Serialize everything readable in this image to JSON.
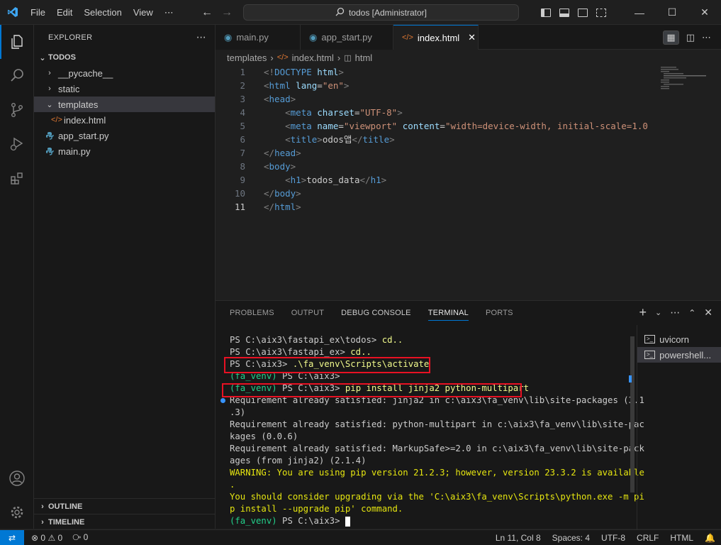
{
  "titlebar": {
    "menu": [
      "File",
      "Edit",
      "Selection",
      "View",
      "⋯"
    ],
    "search": "todos [Administrator]"
  },
  "sidebar": {
    "header": "EXPLORER",
    "root": "TODOS",
    "items": [
      {
        "label": "__pycache__",
        "kind": "folder-collapsed"
      },
      {
        "label": "static",
        "kind": "folder-collapsed"
      },
      {
        "label": "templates",
        "kind": "folder-expanded"
      },
      {
        "label": "index.html",
        "kind": "html-file"
      },
      {
        "label": "app_start.py",
        "kind": "py-file"
      },
      {
        "label": "main.py",
        "kind": "py-file"
      }
    ],
    "outline": "OUTLINE",
    "timeline": "TIMELINE"
  },
  "editor": {
    "tabs": [
      {
        "label": "main.py",
        "icon": "python-icon"
      },
      {
        "label": "app_start.py",
        "icon": "python-icon"
      },
      {
        "label": "index.html",
        "icon": "html-icon",
        "active": true
      }
    ],
    "breadcrumb": [
      "templates",
      "index.html",
      "html"
    ],
    "lines": [
      {
        "n": "1",
        "tokens": [
          [
            "tg",
            "<!"
          ],
          [
            "tn",
            "DOCTYPE"
          ],
          [
            "tx",
            " "
          ],
          [
            "at",
            "html"
          ],
          [
            "tg",
            ">"
          ]
        ]
      },
      {
        "n": "2",
        "tokens": [
          [
            "tg",
            "<"
          ],
          [
            "tn",
            "html"
          ],
          [
            "tx",
            " "
          ],
          [
            "at",
            "lang"
          ],
          [
            "tx",
            "="
          ],
          [
            "av",
            "\"en\""
          ],
          [
            "tg",
            ">"
          ]
        ]
      },
      {
        "n": "3",
        "tokens": [
          [
            "tg",
            "<"
          ],
          [
            "tn",
            "head"
          ],
          [
            "tg",
            ">"
          ]
        ]
      },
      {
        "n": "4",
        "tokens": [
          [
            "tx",
            "    "
          ],
          [
            "tg",
            "<"
          ],
          [
            "tn",
            "meta"
          ],
          [
            "tx",
            " "
          ],
          [
            "at",
            "charset"
          ],
          [
            "tx",
            "="
          ],
          [
            "av",
            "\"UTF-8\""
          ],
          [
            "tg",
            ">"
          ]
        ]
      },
      {
        "n": "5",
        "tokens": [
          [
            "tx",
            "    "
          ],
          [
            "tg",
            "<"
          ],
          [
            "tn",
            "meta"
          ],
          [
            "tx",
            " "
          ],
          [
            "at",
            "name"
          ],
          [
            "tx",
            "="
          ],
          [
            "av",
            "\"viewport\""
          ],
          [
            "tx",
            " "
          ],
          [
            "at",
            "content"
          ],
          [
            "tx",
            "="
          ],
          [
            "av",
            "\"width=device-width, initial-scale=1.0"
          ]
        ]
      },
      {
        "n": "6",
        "tokens": [
          [
            "tx",
            "    "
          ],
          [
            "tg",
            "<"
          ],
          [
            "tn",
            "title"
          ],
          [
            "tg",
            ">"
          ],
          [
            "tx",
            "odos앱"
          ],
          [
            "tg",
            "</"
          ],
          [
            "tn",
            "title"
          ],
          [
            "tg",
            ">"
          ]
        ]
      },
      {
        "n": "7",
        "tokens": [
          [
            "tg",
            "</"
          ],
          [
            "tn",
            "head"
          ],
          [
            "tg",
            ">"
          ]
        ]
      },
      {
        "n": "8",
        "tokens": [
          [
            "tg",
            "<"
          ],
          [
            "tn",
            "body"
          ],
          [
            "tg",
            ">"
          ]
        ]
      },
      {
        "n": "9",
        "tokens": [
          [
            "tx",
            "    "
          ],
          [
            "tg",
            "<"
          ],
          [
            "tn",
            "h1"
          ],
          [
            "tg",
            ">"
          ],
          [
            "tx",
            "todos_data"
          ],
          [
            "tg",
            "</"
          ],
          [
            "tn",
            "h1"
          ],
          [
            "tg",
            ">"
          ]
        ]
      },
      {
        "n": "10",
        "tokens": [
          [
            "tg",
            "</"
          ],
          [
            "tn",
            "body"
          ],
          [
            "tg",
            ">"
          ]
        ]
      },
      {
        "n": "11",
        "tokens": [
          [
            "tg",
            "</"
          ],
          [
            "tn",
            "html"
          ],
          [
            "tg",
            ">"
          ]
        ],
        "current": true
      }
    ]
  },
  "panel": {
    "tabs": [
      "PROBLEMS",
      "OUTPUT",
      "DEBUG CONSOLE",
      "TERMINAL",
      "PORTS"
    ],
    "active_tab": "TERMINAL",
    "terminal_lines": [
      [
        [
          "p",
          "PS C:\\aix3\\fastapi_ex\\todos> "
        ],
        [
          "cmd",
          "cd.."
        ]
      ],
      [
        [
          "p",
          "PS C:\\aix3\\fastapi_ex> "
        ],
        [
          "cmd",
          "cd.."
        ]
      ],
      [
        [
          "p",
          "PS C:\\aix3> "
        ],
        [
          "cmd",
          ".\\fa_venv\\Scripts\\activate"
        ]
      ],
      [
        [
          "venv",
          "(fa_venv) "
        ],
        [
          "p",
          "PS C:\\aix3>"
        ]
      ],
      [
        [
          "venv",
          "(fa_venv) "
        ],
        [
          "p",
          "PS C:\\aix3> "
        ],
        [
          "cmd",
          "pip install jinja2 python-multipart"
        ]
      ],
      [
        [
          "p",
          "Requirement already satisfied: jinja2 in c:\\aix3\\fa_venv\\lib\\site-packages (3.1"
        ]
      ],
      [
        [
          "p",
          ".3)"
        ]
      ],
      [
        [
          "p",
          "Requirement already satisfied: python-multipart in c:\\aix3\\fa_venv\\lib\\site-pac"
        ]
      ],
      [
        [
          "p",
          "kages (0.0.6)"
        ]
      ],
      [
        [
          "p",
          "Requirement already satisfied: MarkupSafe>=2.0 in c:\\aix3\\fa_venv\\lib\\site-pack"
        ]
      ],
      [
        [
          "p",
          "ages (from jinja2) (2.1.4)"
        ]
      ],
      [
        [
          "warn",
          "WARNING: You are using pip version 21.2.3; however, version 23.3.2 is available"
        ]
      ],
      [
        [
          "warn",
          "."
        ]
      ],
      [
        [
          "warn",
          "You should consider upgrading via the 'C:\\aix3\\fa_venv\\Scripts\\python.exe -m pi"
        ]
      ],
      [
        [
          "warn",
          "p install --upgrade pip' command."
        ]
      ],
      [
        [
          "venv",
          "(fa_venv) "
        ],
        [
          "p",
          "PS C:\\aix3> "
        ]
      ]
    ],
    "terminals": [
      "uvicorn",
      "powershell..."
    ]
  },
  "statusbar": {
    "errors": "0",
    "warnings": "0",
    "ports": "0",
    "position": "Ln 11, Col 8",
    "spaces": "Spaces: 4",
    "encoding": "UTF-8",
    "eol": "CRLF",
    "language": "HTML"
  },
  "colors": {
    "accent": "#0078d4",
    "highlight_box": "#e81123"
  }
}
